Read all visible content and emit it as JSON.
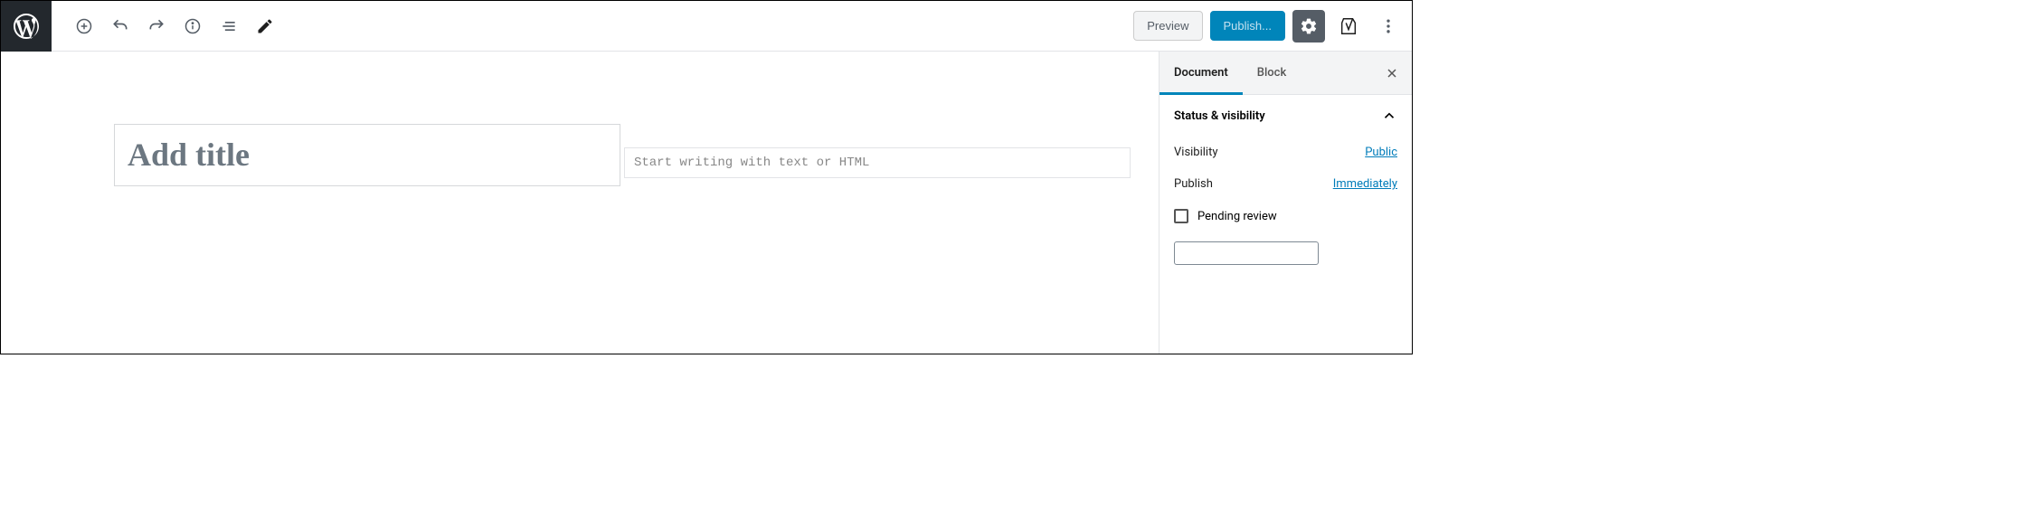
{
  "toolbar": {
    "preview_label": "Preview",
    "publish_label": "Publish..."
  },
  "editor": {
    "title_placeholder": "Add title",
    "body_placeholder": "Start writing with text or HTML"
  },
  "sidebar": {
    "tabs": {
      "document": "Document",
      "block": "Block"
    },
    "panel": {
      "title": "Status & visibility",
      "visibility_label": "Visibility",
      "visibility_value": "Public",
      "publish_label": "Publish",
      "publish_value": "Immediately",
      "pending_review_label": "Pending review"
    }
  }
}
